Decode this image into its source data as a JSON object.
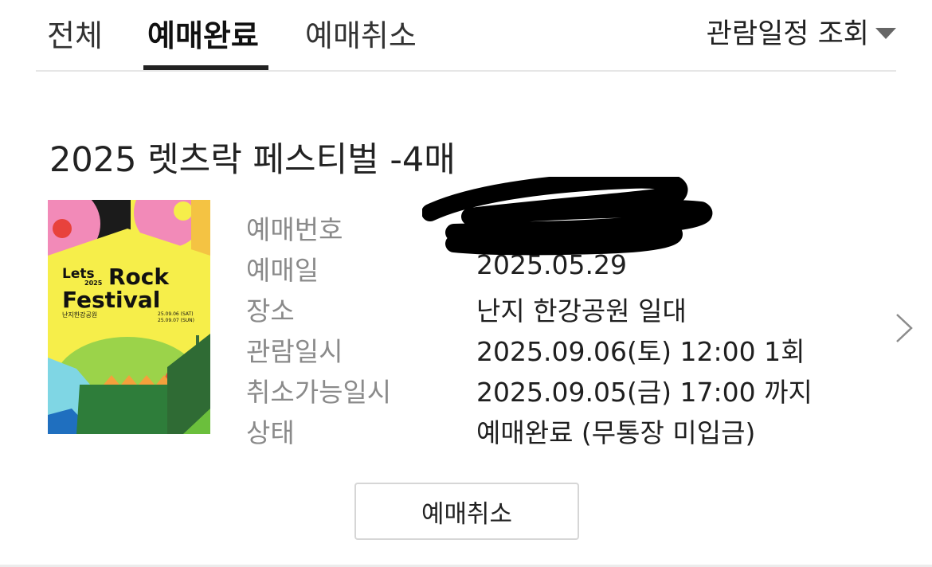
{
  "tabs": [
    {
      "label": "전체"
    },
    {
      "label": "예매완료",
      "active": true
    },
    {
      "label": "예매취소"
    }
  ],
  "schedule_filter": {
    "label": "관람일정 조회"
  },
  "booking": {
    "title": "2025 렛츠락 페스티벌 -4매",
    "poster": {
      "line1": "Lets",
      "year": "2025",
      "line2": "Rock",
      "line3": "Festival",
      "venue": "난지한강공원",
      "date1": "25.09.06 (SAT)",
      "date2": "25.09.07 (SUN)"
    },
    "fields": [
      {
        "label": "예매번호",
        "value": ""
      },
      {
        "label": "예매일",
        "value": "2025.05.29"
      },
      {
        "label": "장소",
        "value": "난지 한강공원 일대"
      },
      {
        "label": "관람일시",
        "value": "2025.09.06(토) 12:00 1회"
      },
      {
        "label": "취소가능일시",
        "value": "2025.09.05(금) 17:00 까지"
      },
      {
        "label": "상태",
        "value": "예매완료 (무통장 미입금)"
      }
    ]
  },
  "actions": {
    "cancel_label": "예매취소"
  },
  "icons": {
    "detail_arrow": "chevron-right-icon",
    "dropdown": "caret-down-icon"
  }
}
